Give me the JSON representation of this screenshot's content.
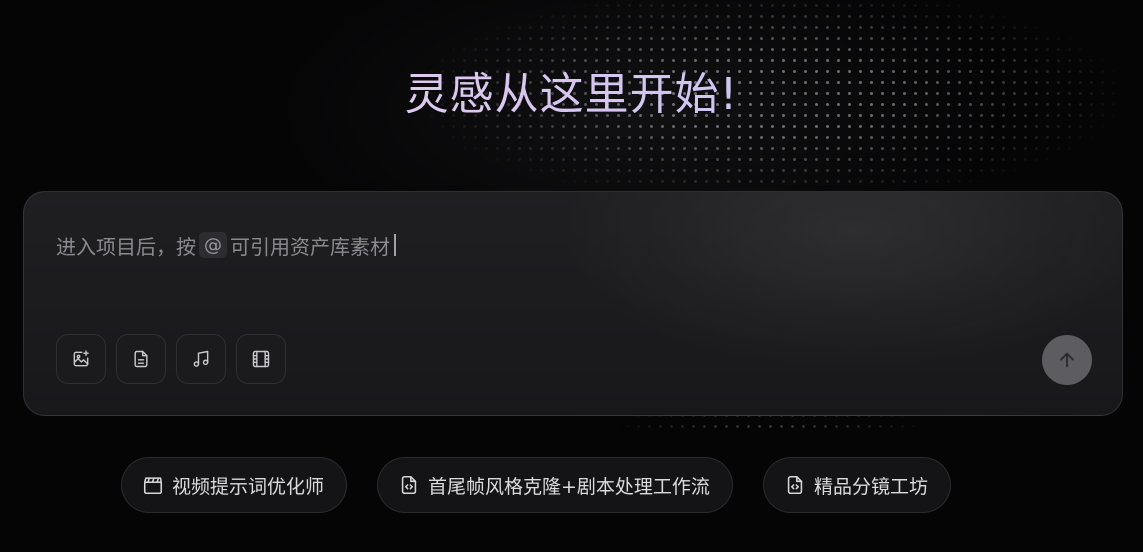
{
  "headline": "灵感从这里开始!",
  "composer": {
    "placeholder_before": "进入项目后，按",
    "placeholder_at": "@",
    "placeholder_after": "可引用资产库素材",
    "tools": [
      {
        "icon": "image-add-icon"
      },
      {
        "icon": "document-icon"
      },
      {
        "icon": "music-note-icon"
      },
      {
        "icon": "film-icon"
      }
    ],
    "send_icon": "arrow-up-icon"
  },
  "shortcuts": [
    {
      "label": "视频提示词优化师",
      "icon": "clapperboard-icon"
    },
    {
      "label": "首尾帧风格克隆+剧本处理工作流",
      "icon": "code-file-icon"
    },
    {
      "label": "精品分镜工坊",
      "icon": "code-file-icon"
    }
  ],
  "colors": {
    "background": "#050506",
    "panel": "#1c1c1f",
    "send_button": "#5c5c61",
    "headline_gradient_start": "#f2d9ec",
    "headline_gradient_end": "#b9c6f4"
  }
}
